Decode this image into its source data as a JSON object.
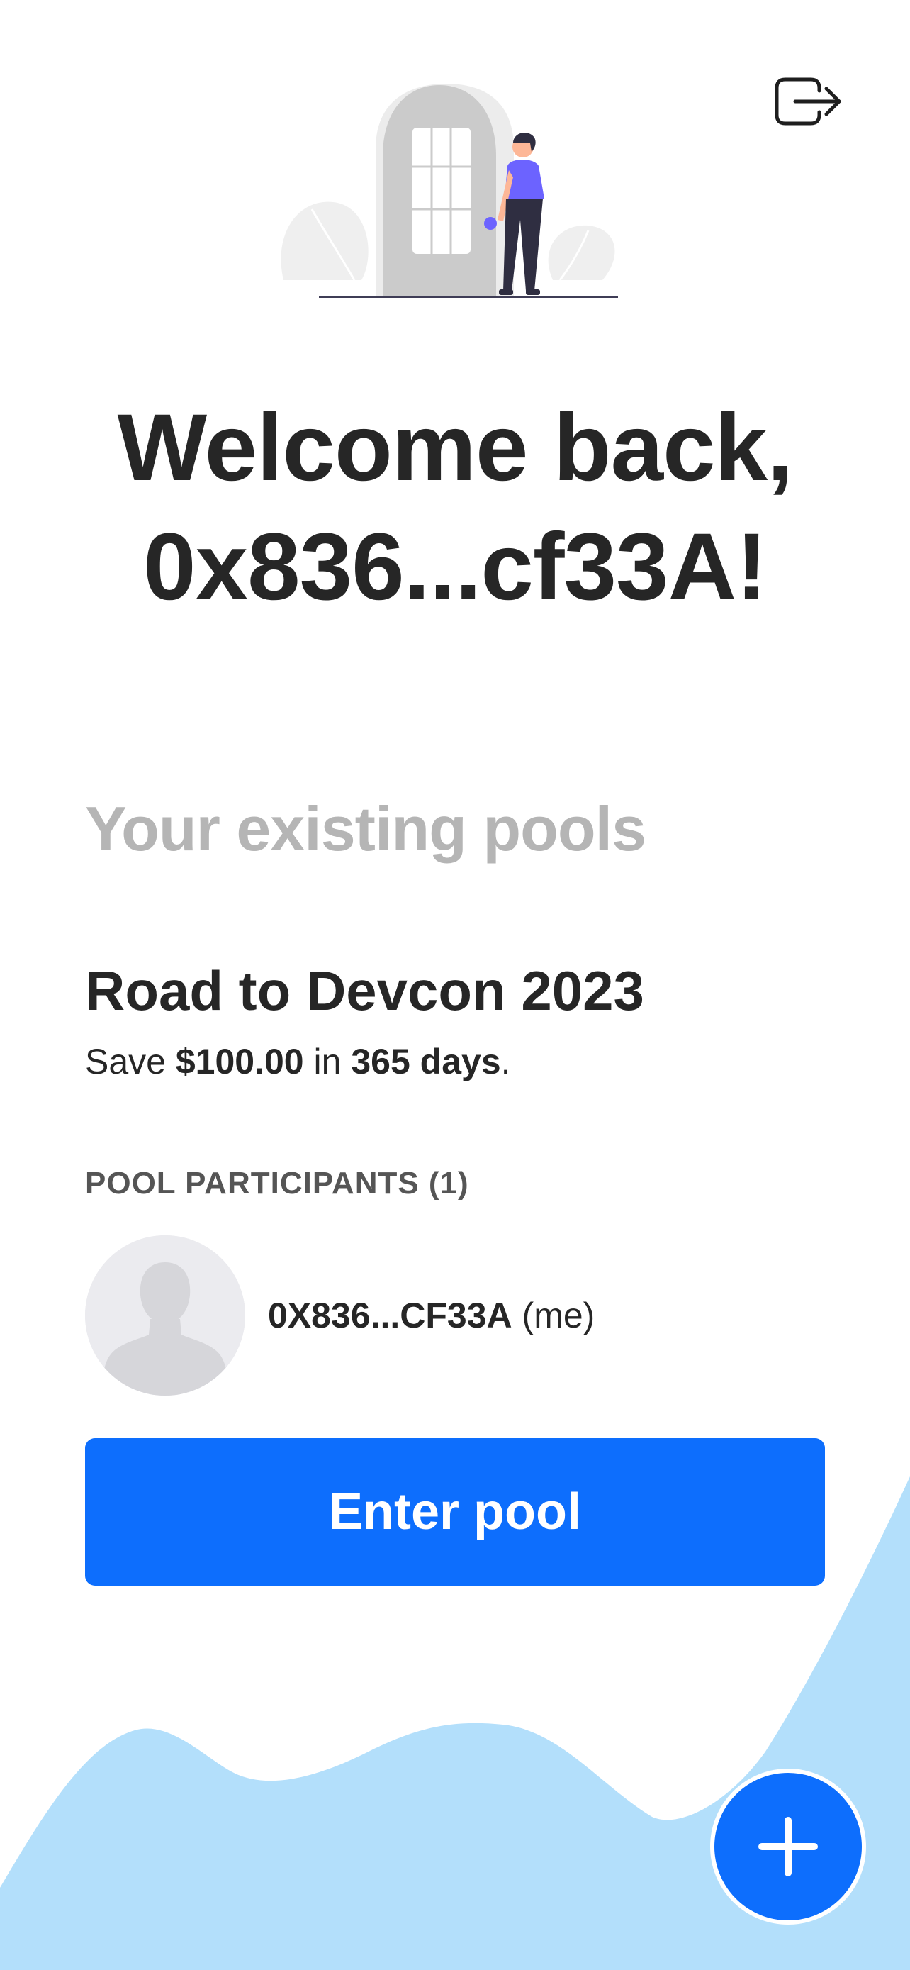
{
  "header": {
    "logout_icon": "logout-icon"
  },
  "hero": {
    "illustration": "person-at-door-illustration"
  },
  "welcome": {
    "line1": "Welcome back,",
    "line2": "0x836...cf33A!"
  },
  "pools_section": {
    "title": "Your existing pools"
  },
  "pool": {
    "name": "Road to Devcon 2023",
    "summary_prefix": "Save",
    "amount": "$100.00",
    "summary_mid": "in",
    "duration": "365 days",
    "summary_suffix": "."
  },
  "participants": {
    "label": "POOL PARTICIPANTS (1)",
    "items": [
      {
        "address": "0X836...CF33A",
        "tag": "(me)"
      }
    ]
  },
  "actions": {
    "enter_label": "Enter pool",
    "add_icon": "plus-icon"
  },
  "colors": {
    "primary": "#0d6efd",
    "wave": "#b3dffb",
    "muted_heading": "#b5b5b5",
    "text": "#262626"
  }
}
